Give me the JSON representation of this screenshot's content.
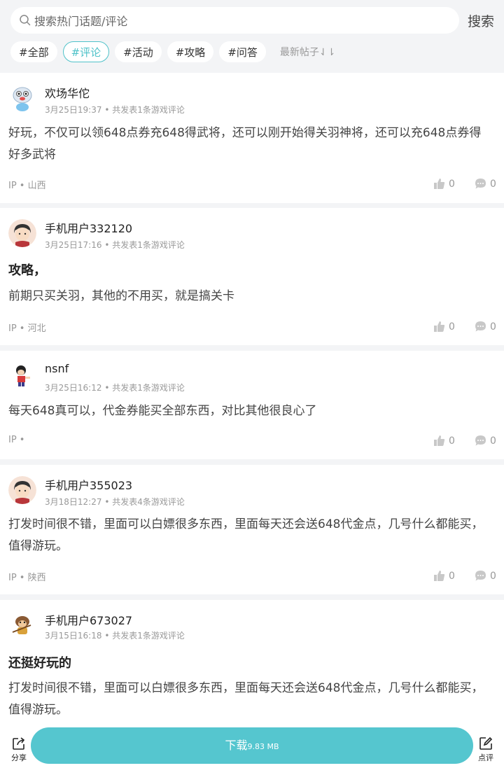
{
  "search": {
    "placeholder": "搜索热门话题/评论",
    "button": "搜索"
  },
  "tags": [
    "#全部",
    "#评论",
    "#活动",
    "#攻略",
    "#问答"
  ],
  "active_tag_index": 1,
  "sort_label": "最新帖子⇃⇂",
  "accent_color": "#4fc2c9",
  "posts": [
    {
      "user": "欢场华佗",
      "date": "3月25日19:37",
      "info": "共发表1条游戏评论",
      "title": "",
      "text": "好玩，不仅可以领648点券充648得武将，还可以刚开始得关羽神将，还可以充648点券得好多武将",
      "ip": "IP • 山西",
      "likes": "0",
      "comments": "0",
      "avatar": "snowman-avatar"
    },
    {
      "user": "手机用户332120",
      "date": "3月25日17:16",
      "info": "共发表1条游戏评论",
      "title": "攻略，",
      "text": "前期只买关羽，其他的不用买，就是搞关卡",
      "ip": "IP • 河北",
      "likes": "0",
      "comments": "0",
      "avatar": "boy-avatar"
    },
    {
      "user": "nsnf",
      "date": "3月25日16:12",
      "info": "共发表1条游戏评论",
      "title": "",
      "text": "每天648真可以，代金券能买全部东西，对比其他很良心了",
      "ip": "IP •",
      "likes": "0",
      "comments": "0",
      "avatar": "cartoon-avatar"
    },
    {
      "user": "手机用户355023",
      "date": "3月18日12:27",
      "info": "共发表4条游戏评论",
      "title": "",
      "text": "打发时间很不错，里面可以白嫖很多东西，里面每天还会送648代金点，几号什么都能买，值得游玩。",
      "ip": "IP • 陕西",
      "likes": "0",
      "comments": "0",
      "avatar": "boy-avatar"
    },
    {
      "user": "手机用户673027",
      "date": "3月15日16:18",
      "info": "共发表1条游戏评论",
      "title": "还挺好玩的",
      "text": "打发时间很不错，里面可以白嫖很多东西，里面每天还会送648代金点，几号什么都能买，值得游玩。",
      "ip": "",
      "likes": "",
      "comments": "",
      "avatar": "monkey-avatar"
    }
  ],
  "bottom": {
    "share": "分享",
    "download": "下载",
    "size": "9.83 MB",
    "review": "点评"
  }
}
